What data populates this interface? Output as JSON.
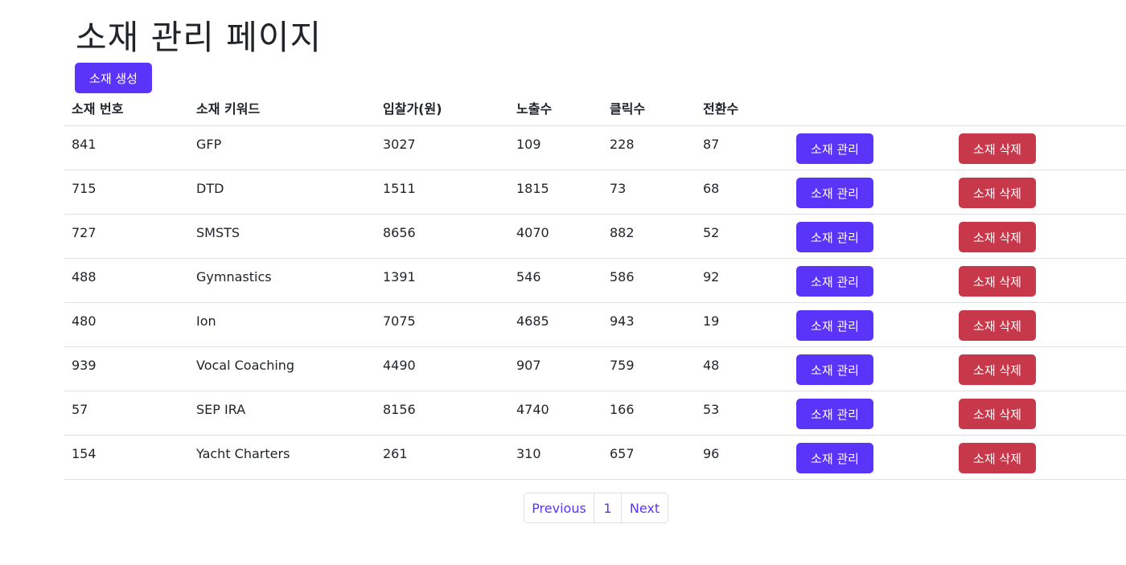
{
  "page": {
    "title": "소재 관리 페이지",
    "create_button": "소재 생성"
  },
  "colors": {
    "primary": "#5b34fa",
    "danger": "#c8384b",
    "border": "#dee2e6"
  },
  "table": {
    "headers": [
      "소재 번호",
      "소재 키워드",
      "입찰가(원)",
      "노출수",
      "클릭수",
      "전환수"
    ],
    "manage_label": "소재 관리",
    "delete_label": "소재 삭제",
    "rows": [
      [
        "841",
        "GFP",
        "3027",
        "109",
        "228",
        "87"
      ],
      [
        "715",
        "DTD",
        "1511",
        "1815",
        "73",
        "68"
      ],
      [
        "727",
        "SMSTS",
        "8656",
        "4070",
        "882",
        "52"
      ],
      [
        "488",
        "Gymnastics",
        "1391",
        "546",
        "586",
        "92"
      ],
      [
        "480",
        "Ion",
        "7075",
        "4685",
        "943",
        "19"
      ],
      [
        "939",
        "Vocal Coaching",
        "4490",
        "907",
        "759",
        "48"
      ],
      [
        "57",
        "SEP IRA",
        "8156",
        "4740",
        "166",
        "53"
      ],
      [
        "154",
        "Yacht Charters",
        "261",
        "310",
        "657",
        "96"
      ]
    ]
  },
  "pagination": {
    "previous": "Previous",
    "current": "1",
    "next": "Next"
  }
}
